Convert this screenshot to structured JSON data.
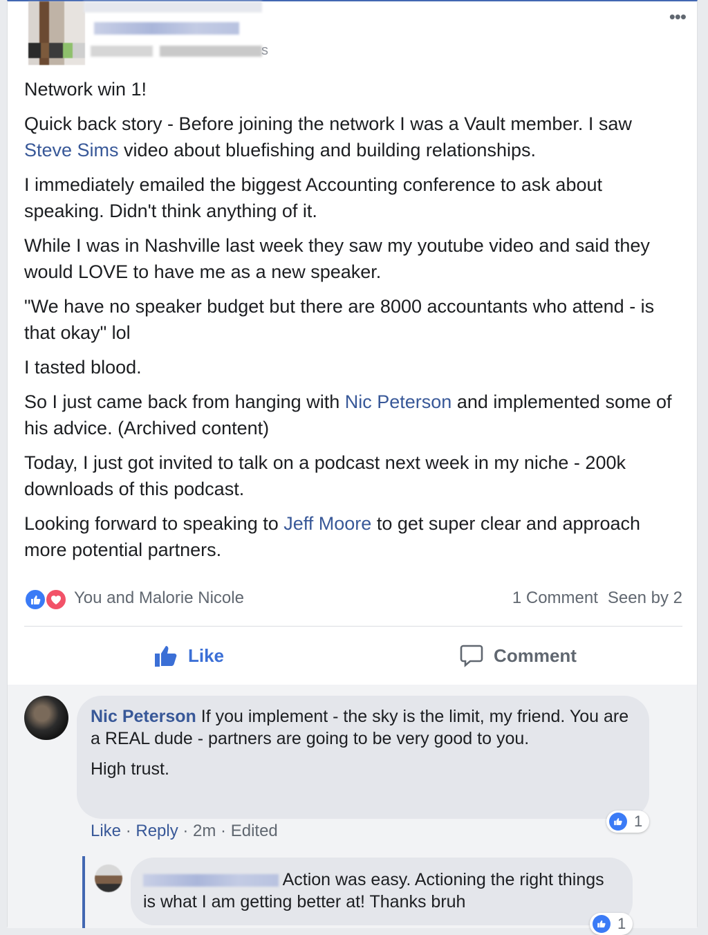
{
  "post": {
    "author_suffix": "s",
    "paragraphs": [
      {
        "id": "p1",
        "text": "Network win 1!"
      },
      {
        "id": "p2",
        "before": "Quick back story - Before joining the network I was a Vault member. I saw ",
        "mention": "Steve Sims",
        "after": " video about bluefishing and building relationships."
      },
      {
        "id": "p3",
        "text": "I immediately emailed the biggest Accounting conference to ask about speaking. Didn't think anything of it."
      },
      {
        "id": "p4",
        "text": "While I was in Nashville last week they saw my youtube video and said they would LOVE to have me as a new speaker."
      },
      {
        "id": "p5",
        "text": "\"We have no speaker budget but there are 8000 accountants who attend - is that okay\" lol"
      },
      {
        "id": "p6",
        "text": "I tasted blood."
      },
      {
        "id": "p7",
        "before": "So I just came back from hanging with ",
        "mention": "Nic Peterson",
        "after": " and implemented some of his advice. (Archived content)"
      },
      {
        "id": "p8",
        "text": "Today, I just got invited to talk on a podcast next week in my niche - 200k downloads of this podcast."
      },
      {
        "id": "p9",
        "before": "Looking forward to speaking to ",
        "mention": "Jeff Moore",
        "after": " to get super clear and approach more potential partners."
      }
    ],
    "reactors_text": "You and Malorie Nicole",
    "comment_count": "1 Comment",
    "seen_by": "Seen by 2",
    "like_label": "Like",
    "comment_label": "Comment",
    "icons": {
      "more": "more-options-icon",
      "like": "thumbs-up-icon",
      "comment": "speech-bubble-icon",
      "love": "heart-icon"
    },
    "colors": {
      "link": "#385898",
      "like_blue": "#3b6fd6",
      "love_red": "#f25268"
    }
  },
  "comment": {
    "author": "Nic Peterson",
    "line1": " If you implement - the sky is the limit, my friend. You are a REAL dude - partners are going to be very good to you.",
    "line2": "High trust.",
    "like_label": "Like",
    "reply_label": "Reply",
    "time": "2m",
    "edited": "Edited",
    "reaction_count": "1"
  },
  "reply": {
    "text": "Action was easy. Actioning the right things is what I am getting better at! Thanks bruh",
    "reaction_count": "1"
  }
}
